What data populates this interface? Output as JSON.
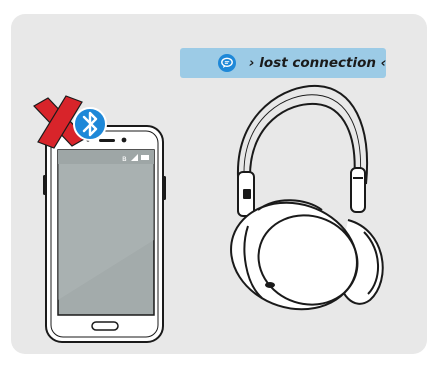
{
  "status": {
    "message": "› lost connection ‹",
    "icon": "speech-bubble-icon"
  },
  "colors": {
    "panel": "#e8e8e8",
    "banner": "#9ccbe6",
    "bluetooth": "#1e88d8",
    "cross": "#d8242a",
    "screen": "#a3abab"
  }
}
